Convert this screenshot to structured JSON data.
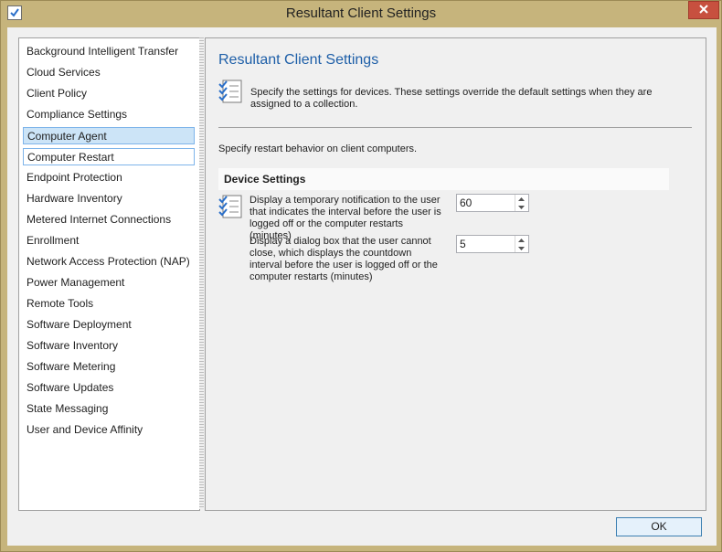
{
  "window": {
    "title": "Resultant Client Settings"
  },
  "nav": {
    "items": [
      {
        "label": "Background Intelligent Transfer"
      },
      {
        "label": "Cloud Services"
      },
      {
        "label": "Client Policy"
      },
      {
        "label": "Compliance Settings"
      },
      {
        "label": "Computer Agent",
        "selected": true
      },
      {
        "label": "Computer Restart",
        "focused": true
      },
      {
        "label": "Endpoint Protection"
      },
      {
        "label": "Hardware Inventory"
      },
      {
        "label": "Metered Internet Connections"
      },
      {
        "label": "Enrollment"
      },
      {
        "label": "Network Access Protection (NAP)"
      },
      {
        "label": "Power Management"
      },
      {
        "label": "Remote Tools"
      },
      {
        "label": "Software Deployment"
      },
      {
        "label": "Software Inventory"
      },
      {
        "label": "Software Metering"
      },
      {
        "label": "Software Updates"
      },
      {
        "label": "State Messaging"
      },
      {
        "label": "User and Device Affinity"
      }
    ]
  },
  "content": {
    "title": "Resultant Client Settings",
    "description": "Specify the settings for devices. These settings override the default settings when they are assigned to a collection.",
    "restart_note": "Specify restart behavior on client computers.",
    "group_header": "Device Settings",
    "settings": [
      {
        "label": "Display a temporary notification to the user that indicates the interval before the user is logged off or the computer restarts (minutes)",
        "value": "60"
      },
      {
        "label": "Display a dialog box that the user cannot close, which displays the countdown interval before the user is logged off or the computer restarts (minutes)",
        "value": "5"
      }
    ]
  },
  "footer": {
    "ok_label": "OK"
  },
  "icons": {
    "app": "checklist-icon",
    "close": "close-icon",
    "settings": "settings-checklist-icon"
  },
  "colors": {
    "title_bar": "#c6b47c",
    "close_button": "#c7503f",
    "heading_blue": "#1e5fa8",
    "selection": "#cce4f7"
  }
}
